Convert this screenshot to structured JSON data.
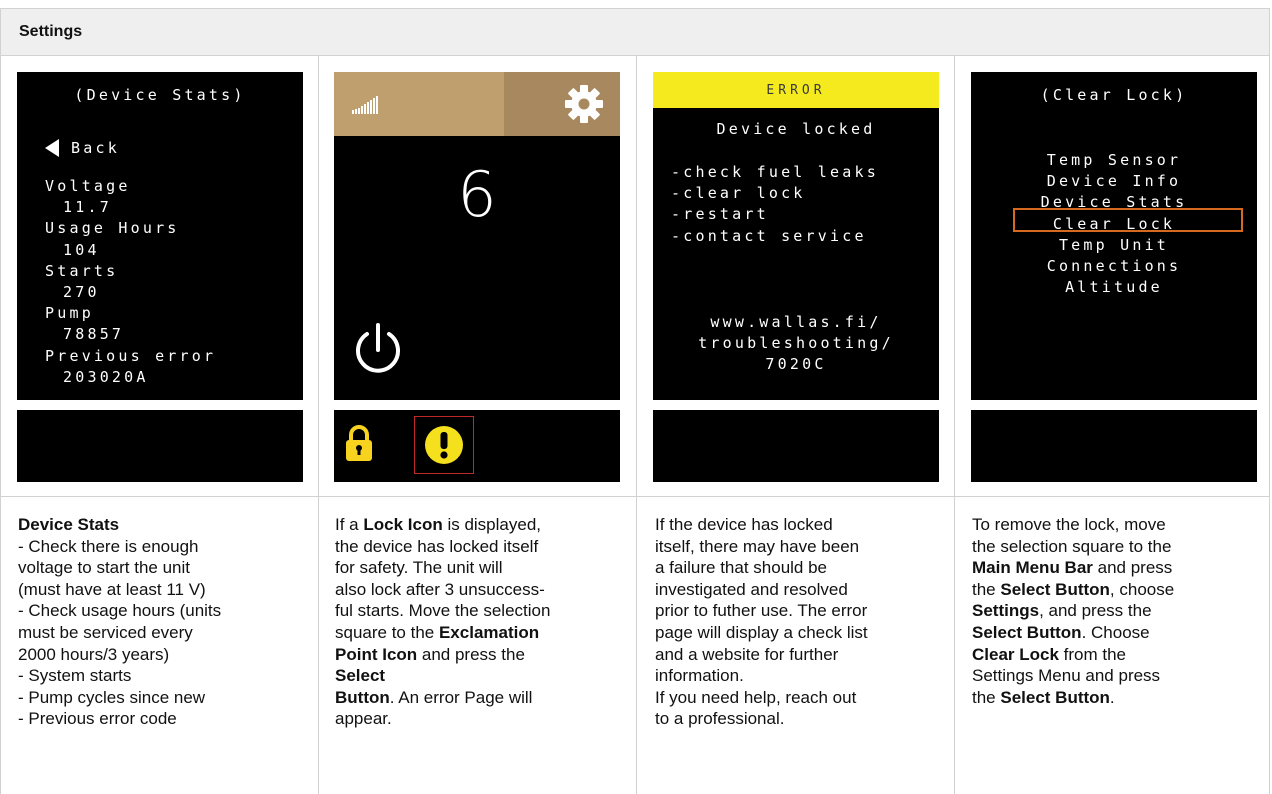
{
  "header": {
    "title": "Settings"
  },
  "screens": {
    "device_stats": {
      "title": "(Device Stats)",
      "back": "Back",
      "items": [
        {
          "label": "Voltage",
          "value": "11.7"
        },
        {
          "label": "Usage Hours",
          "value": "104"
        },
        {
          "label": "Starts",
          "value": "270"
        },
        {
          "label": "Pump",
          "value": "78857"
        },
        {
          "label": "Previous error",
          "value": "203020A"
        }
      ]
    },
    "main": {
      "value": "6",
      "colors": {
        "top_left": "#bf9f6e",
        "top_right": "#a8885e",
        "lock": "#f7d21f",
        "warning": "#f4e01c",
        "selection": "#c0282a"
      },
      "icons": [
        "signal-strength-icon",
        "gear-icon",
        "power-icon",
        "lock-icon",
        "exclamation-icon"
      ]
    },
    "error": {
      "banner": "ERROR",
      "subtitle": "Device locked",
      "checklist": [
        "-check fuel leaks",
        "-clear lock",
        "-restart",
        "-contact service"
      ],
      "url_lines": [
        "www.wallas.fi/",
        "troubleshooting/",
        "7020C"
      ]
    },
    "clear_lock": {
      "title": "(Clear Lock)",
      "menu": [
        "Temp Sensor",
        "Device Info",
        "Device Stats",
        "Clear Lock",
        "Temp Unit",
        "Connections",
        "Altitude"
      ],
      "selected": "Clear Lock"
    }
  },
  "descriptions": {
    "col1": {
      "heading": "Device Stats",
      "lines": [
        "- Check there is enough",
        "voltage to start the unit",
        "(must have at least 11 V)",
        "- Check usage hours (units",
        "must be serviced every",
        "2000 hours/3 years)",
        "- System starts",
        "- Pump cycles since new",
        "- Previous error code"
      ]
    },
    "col2": {
      "p1": "If a ",
      "b1": "Lock Icon",
      "p2": " is displayed,",
      "l2": "the device has locked itself",
      "l3": "for safety. The unit will",
      "l4": "also lock after 3 unsuccess-",
      "l5": "ful starts. Move the selection",
      "p6": "square to the ",
      "b6": "Exclamation",
      "b7": "Point Icon",
      "p7": " and press the",
      "b8": "Select",
      "b9": "Button",
      "p9": ". An error Page will",
      "l10": "appear."
    },
    "col3": {
      "lines": [
        "If the device has locked",
        "itself, there may have been",
        "a failure that should be",
        "investigated and resolved",
        "prior to futher use. The error",
        "page will display a check list",
        "and a website for further",
        "information.",
        "If you need help, reach out",
        "to a professional."
      ]
    },
    "col4": {
      "l1": "To remove the lock, move",
      "l2": "the selection square to the",
      "b3": "Main Menu Bar",
      "p3": " and press",
      "p4a": "the ",
      "b4": "Select Button",
      "p4b": ", choose",
      "b5": "Settings",
      "p5": ", and press the",
      "b6": "Select Button",
      "p6": ". Choose",
      "b7": "Clear Lock",
      "p7": " from the",
      "l8": "Settings Menu and press",
      "p9a": "the ",
      "b9": "Select Button",
      "p9b": "."
    }
  }
}
